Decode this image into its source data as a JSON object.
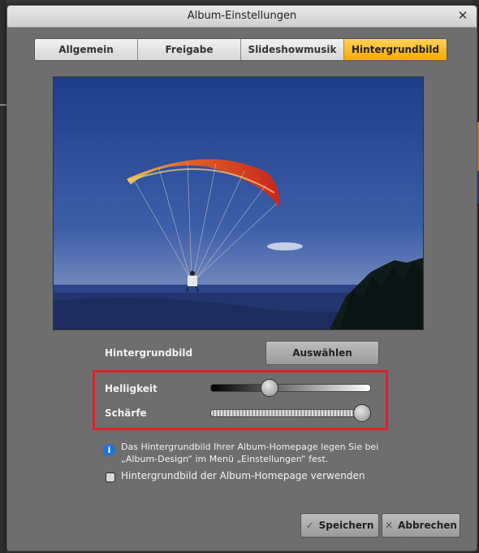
{
  "dialog": {
    "title": "Album-Einstellungen",
    "close_glyph": "✕"
  },
  "tabs": [
    {
      "label": "Allgemein",
      "active": false
    },
    {
      "label": "Freigabe",
      "active": false
    },
    {
      "label": "Slideshowmusik",
      "active": false
    },
    {
      "label": "Hintergrundbild",
      "active": true
    }
  ],
  "background": {
    "label": "Hintergrundbild",
    "choose_button": "Auswählen"
  },
  "sliders": {
    "brightness_label": "Helligkeit",
    "brightness_value": 0.35,
    "sharpness_label": "Schärfe",
    "sharpness_value": 1.0
  },
  "info": {
    "icon": "info-icon",
    "text": "Das Hintergrundbild Ihrer Album-Homepage legen Sie bei „Album-Design“ im Menü „Einstellungen“ fest."
  },
  "checkbox": {
    "label": "Hintergrundbild der Album-Homepage verwenden",
    "checked": false
  },
  "buttons": {
    "save": "Speichern",
    "cancel": "Abbrechen"
  },
  "colors": {
    "accent": "#f7a800",
    "highlight_border": "#e0202a",
    "dialog_bg": "#6e6e6e"
  }
}
